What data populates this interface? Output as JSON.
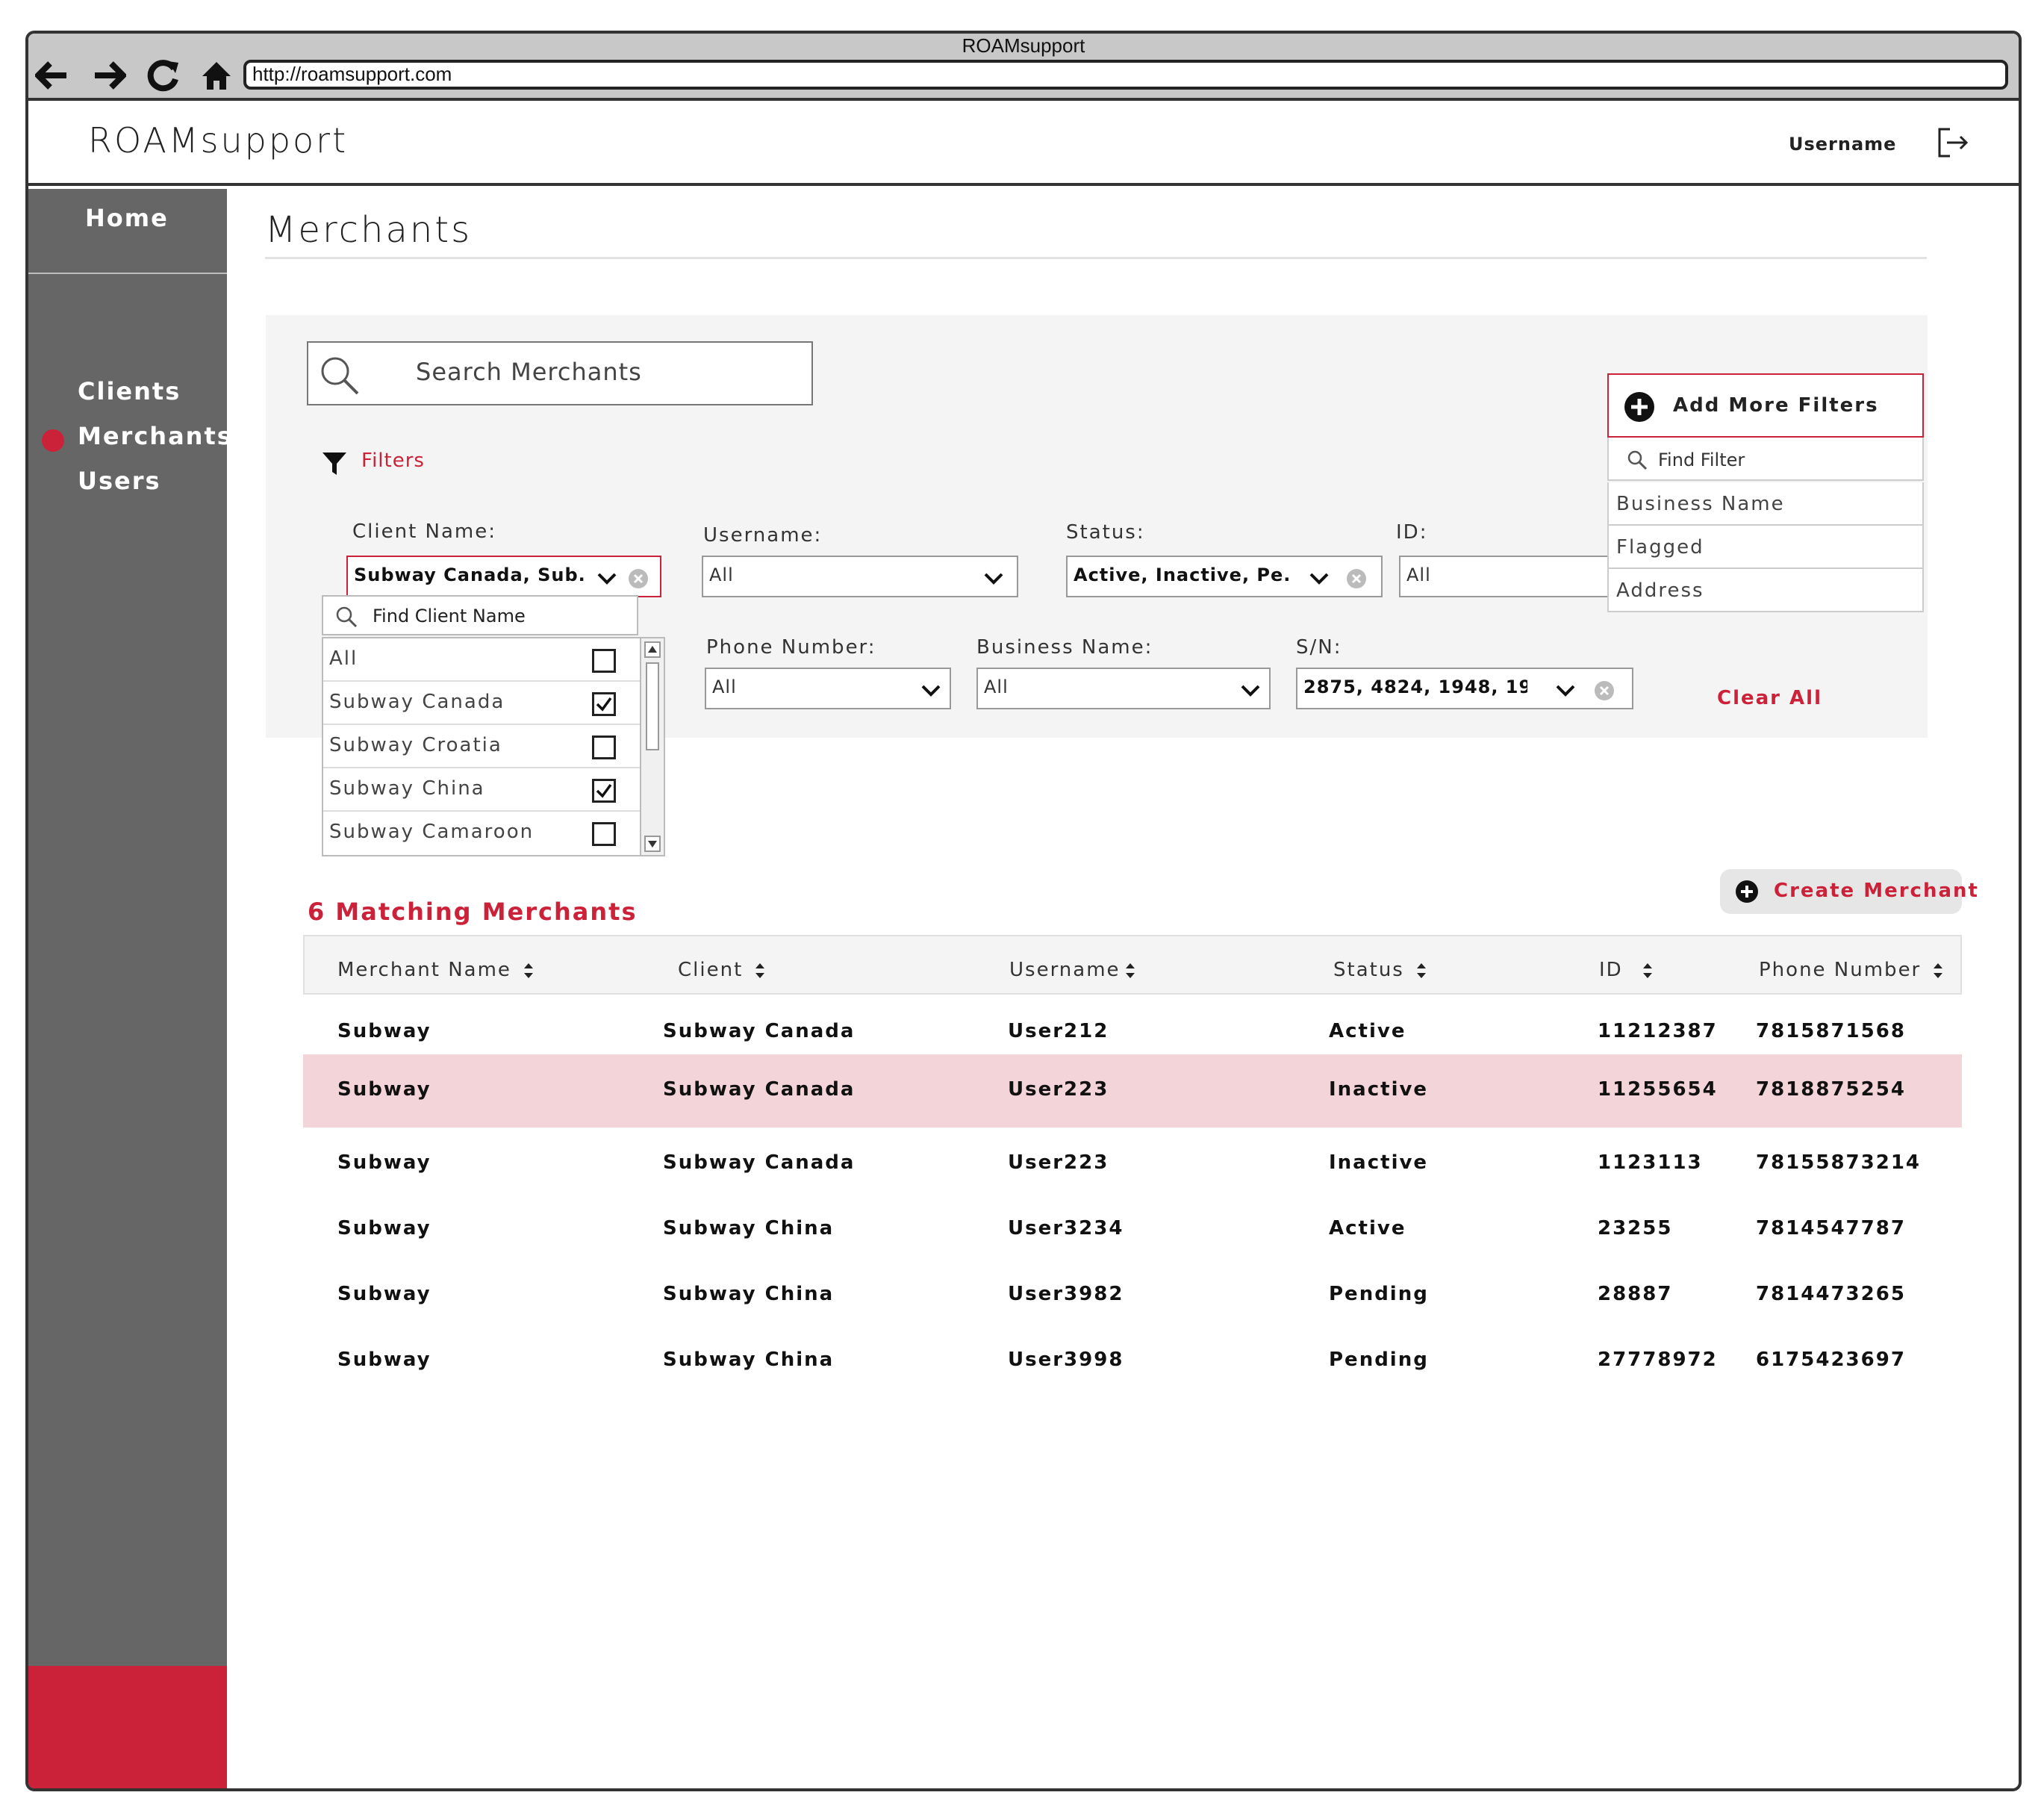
{
  "browser": {
    "window_title": "ROAMsupport",
    "url": "http://roamsupport.com"
  },
  "header": {
    "logo": "ROAMsupport",
    "username": "Username"
  },
  "sidebar": {
    "home": "Home",
    "items": [
      {
        "label": "Clients",
        "active": false
      },
      {
        "label": "Merchants",
        "active": true
      },
      {
        "label": "Users",
        "active": false
      }
    ]
  },
  "page": {
    "title": "Merchants"
  },
  "search": {
    "placeholder": "Search Merchants"
  },
  "filters": {
    "label": "Filters",
    "client_name": {
      "label": "Client Name:",
      "value": "Subway Canada, Sub...",
      "find_placeholder": "Find Client Name",
      "options": [
        {
          "label": "All",
          "checked": false
        },
        {
          "label": "Subway Canada",
          "checked": true
        },
        {
          "label": "Subway Croatia",
          "checked": false
        },
        {
          "label": "Subway China",
          "checked": true
        },
        {
          "label": "Subway Camaroon",
          "checked": false
        }
      ]
    },
    "username": {
      "label": "Username:",
      "value": "All"
    },
    "status": {
      "label": "Status:",
      "value": "Active, Inactive, Pe..."
    },
    "id": {
      "label": "ID:",
      "value": "All"
    },
    "phone_number": {
      "label": "Phone Number:",
      "value": "All"
    },
    "business_name": {
      "label": "Business Name:",
      "value": "All"
    },
    "sn": {
      "label": "S/N:",
      "value": "2875, 4824, 1948, 19..."
    },
    "clear_all": "Clear All",
    "add_more": {
      "label": "Add More Filters",
      "find_placeholder": "Find Filter",
      "options": [
        "Business Name",
        "Flagged",
        "Address"
      ]
    }
  },
  "results": {
    "count_label": "6 Matching Merchants",
    "create_button": "Create Merchant",
    "columns": [
      "Merchant Name",
      "Client",
      "Username",
      "Status",
      "ID",
      "Phone Number"
    ],
    "rows": [
      [
        "Subway",
        "Subway Canada",
        "User212",
        "Active",
        "11212387",
        "7815871568"
      ],
      [
        "Subway",
        "Subway Canada",
        "User223",
        "Inactive",
        "11255654",
        "7818875254"
      ],
      [
        "Subway",
        "Subway Canada",
        "User223",
        "Inactive",
        "1123113",
        "78155873214"
      ],
      [
        "Subway",
        "Subway China",
        "User3234",
        "Active",
        "23255",
        "7814547787"
      ],
      [
        "Subway",
        "Subway China",
        "User3982",
        "Pending",
        "28887",
        "7814473265"
      ],
      [
        "Subway",
        "Subway China",
        "User3998",
        "Pending",
        "27778972",
        "6175423697"
      ]
    ],
    "highlighted_row": 1
  },
  "colors": {
    "accent": "#cc2239",
    "sidebar": "#666666",
    "panel": "#f4f4f4",
    "highlight_row": "#f3d4d8"
  }
}
